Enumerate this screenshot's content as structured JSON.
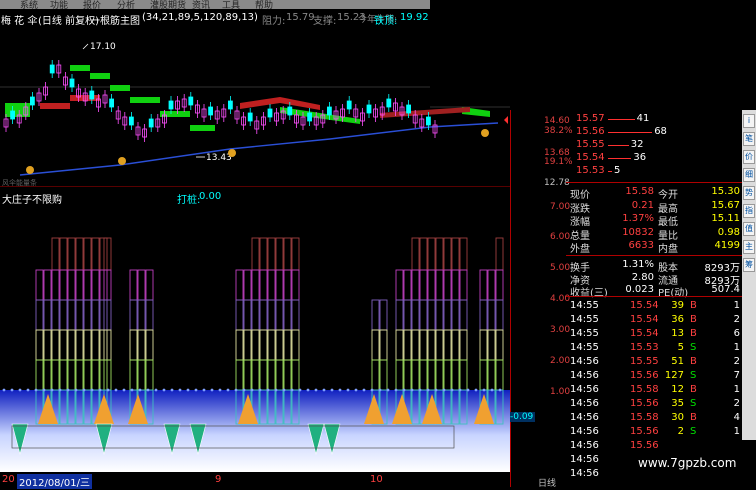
{
  "menu": [
    "系统",
    "功能",
    "报价",
    "分析",
    "灌股期货",
    "资讯",
    "工具",
    "帮助"
  ],
  "title": {
    "name": "梅 花 伞",
    "mode": "(日线 前复权)",
    "indicator": "一根筋主图",
    "params": "(34,21,89,5,120,89,13)",
    "resist_label": "阻力:",
    "resist_value": "15.79",
    "support_label": "支撑:",
    "support_value": "15.23",
    "trend_label": "今年牛熊:",
    "trend_value": "铁顶:",
    "trend_num": "19.92"
  },
  "main_annot": {
    "high": "17.10",
    "low": "13.43",
    "bottom_text": "风伞能量条"
  },
  "price_axis": [
    {
      "value": "14.60",
      "color": "#e04040"
    },
    {
      "value": "38.2%",
      "color": "#e04040"
    },
    {
      "value": "13.68",
      "color": "#e04040"
    },
    {
      "value": "19.1%",
      "color": "#e04040"
    },
    {
      "value": "12.78",
      "color": "#c0c0c0"
    }
  ],
  "ind_axis": [
    "7.00",
    "6.00",
    "5.00",
    "4.00",
    "3.00",
    "2.00",
    "1.00",
    "-0.09"
  ],
  "lower": {
    "name": "大庄子不限购",
    "label": "打桩:",
    "value": "0.00"
  },
  "order_book": [
    {
      "price": "15.57",
      "vol": "41"
    },
    {
      "price": "15.56",
      "vol": "68"
    },
    {
      "price": "15.55",
      "vol": "32"
    },
    {
      "price": "15.54",
      "vol": "36"
    },
    {
      "price": "15.53",
      "vol": "5"
    }
  ],
  "quote": [
    {
      "l1": "现价",
      "v1": "15.58",
      "l2": "今开",
      "v2": "15.30"
    },
    {
      "l1": "涨跌",
      "v1": "0.21",
      "l2": "最高",
      "v2": "15.67"
    },
    {
      "l1": "涨幅",
      "v1": "1.37%",
      "l2": "最低",
      "v2": "15.11"
    },
    {
      "l1": "总量",
      "v1": "10832",
      "l2": "量比",
      "v2": "0.98"
    },
    {
      "l1": "外盘",
      "v1": "6633",
      "l2": "内盘",
      "v2": "4199"
    }
  ],
  "quote2": [
    {
      "l1": "换手",
      "v1": "1.31%",
      "l2": "股本",
      "v2": "8293万"
    },
    {
      "l1": "净资",
      "v1": "2.80",
      "l2": "流通",
      "v2": "8293万"
    },
    {
      "l1": "收益(三)",
      "v1": "0.023",
      "l2": "PE(动)",
      "v2": "507.4"
    }
  ],
  "ticks": [
    {
      "t": "14:55",
      "p": "15.54",
      "v": "39",
      "s": "B",
      "n": "1"
    },
    {
      "t": "14:55",
      "p": "15.54",
      "v": "36",
      "s": "B",
      "n": "2"
    },
    {
      "t": "14:55",
      "p": "15.54",
      "v": "13",
      "s": "B",
      "n": "6"
    },
    {
      "t": "14:55",
      "p": "15.53",
      "v": "5",
      "s": "S",
      "n": "1"
    },
    {
      "t": "14:56",
      "p": "15.55",
      "v": "51",
      "s": "B",
      "n": "2"
    },
    {
      "t": "14:56",
      "p": "15.56",
      "v": "127",
      "s": "S",
      "n": "7"
    },
    {
      "t": "14:56",
      "p": "15.58",
      "v": "12",
      "s": "B",
      "n": "1"
    },
    {
      "t": "14:56",
      "p": "15.56",
      "v": "35",
      "s": "S",
      "n": "2"
    },
    {
      "t": "14:56",
      "p": "15.58",
      "v": "30",
      "s": "B",
      "n": "4"
    },
    {
      "t": "14:56",
      "p": "15.56",
      "v": "2",
      "s": "S",
      "n": "1"
    },
    {
      "t": "14:56",
      "p": "15.56",
      "v": "",
      "s": "",
      "n": ""
    },
    {
      "t": "14:56",
      "p": "",
      "v": "",
      "s": "",
      "n": ""
    },
    {
      "t": "14:56",
      "p": "",
      "v": "",
      "s": "",
      "n": ""
    }
  ],
  "sidebar_buttons": [
    "i",
    "笔",
    "价",
    "细",
    "势",
    "指",
    "值",
    "主",
    "筹"
  ],
  "dates": {
    "start": "2012/08/01/三",
    "m1": "20",
    "m2": "9",
    "m3": "10",
    "period": "日线"
  },
  "watermark": "www.7gpzb.com",
  "colors": {
    "up": "#ff3030",
    "down": "#00e000",
    "accent": "#00ffff",
    "yellow": "#ffff00"
  }
}
